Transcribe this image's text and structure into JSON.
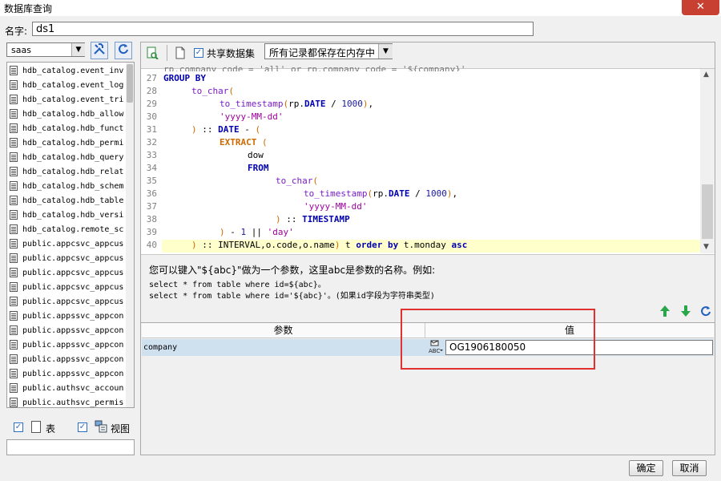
{
  "window": {
    "title": "数据库查询",
    "close_label": "✕"
  },
  "name_row": {
    "label": "名字:",
    "value": "ds1"
  },
  "left": {
    "db_select": "saas",
    "tables": [
      "hdb_catalog.event_inv",
      "hdb_catalog.event_log",
      "hdb_catalog.event_tri",
      "hdb_catalog.hdb_allow",
      "hdb_catalog.hdb_funct",
      "hdb_catalog.hdb_permi",
      "hdb_catalog.hdb_query",
      "hdb_catalog.hdb_relat",
      "hdb_catalog.hdb_schem",
      "hdb_catalog.hdb_table",
      "hdb_catalog.hdb_versi",
      "hdb_catalog.remote_sc",
      "public.appcsvc_appcus",
      "public.appcsvc_appcus",
      "public.appcsvc_appcus",
      "public.appcsvc_appcus",
      "public.appcsvc_appcus",
      "public.appssvc_appcon",
      "public.appssvc_appcon",
      "public.appssvc_appcon",
      "public.appssvc_appcon",
      "public.appssvc_appcon",
      "public.authsvc_accoun",
      "public.authsvc_permis"
    ],
    "chk_table_label": "表",
    "chk_view_label": "视图"
  },
  "toolbar": {
    "share_label": "共享数据集",
    "mode_select": "所有记录都保存在内存中"
  },
  "editor": {
    "lines": [
      {
        "n": "27",
        "t": "GROUP BY"
      },
      {
        "n": "28",
        "t": "to_char("
      },
      {
        "n": "29",
        "t": "to_timestamp(rp.DATE / 1000),"
      },
      {
        "n": "30",
        "t": "'yyyy-MM-dd'"
      },
      {
        "n": "31",
        "t": ") :: DATE - ("
      },
      {
        "n": "32",
        "t": "EXTRACT ("
      },
      {
        "n": "33",
        "t": "dow"
      },
      {
        "n": "34",
        "t": "FROM"
      },
      {
        "n": "35",
        "t": "to_char("
      },
      {
        "n": "36",
        "t": "to_timestamp(rp.DATE / 1000),"
      },
      {
        "n": "37",
        "t": "'yyyy-MM-dd'"
      },
      {
        "n": "38",
        "t": ") :: TIMESTAMP"
      },
      {
        "n": "39",
        "t": ") - 1 || 'day'"
      },
      {
        "n": "40",
        "t": ") :: INTERVAL,o.code,o.name) t order by t.monday asc"
      }
    ],
    "partial_top": "rp.company_code = 'all' or rp.company_code = '${company}'"
  },
  "help": {
    "line1": "您可以键入\"${abc}\"做为一个参数，这里abc是参数的名称。例如:",
    "line2": "select * from table where id=${abc}。",
    "line3": "select * from table where id='${abc}'。(如果id字段为字符串类型)"
  },
  "params": {
    "col_param": "参数",
    "col_value": "值",
    "rows": [
      {
        "name": "company",
        "value": "OG1906180050"
      }
    ]
  },
  "buttons": {
    "ok": "确定",
    "cancel": "取消"
  }
}
